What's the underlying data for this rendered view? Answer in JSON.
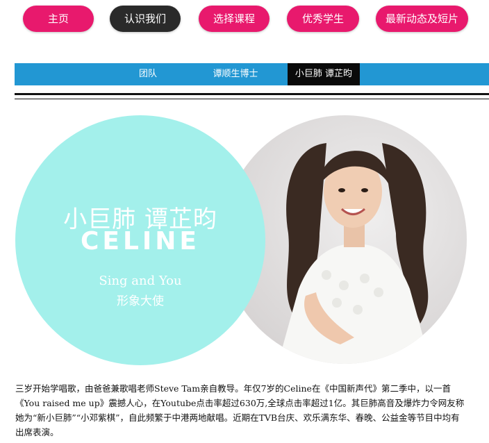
{
  "top_nav": {
    "items": [
      {
        "label": "主页",
        "style": "pink"
      },
      {
        "label": "认识我们",
        "style": "dark"
      },
      {
        "label": "选择课程",
        "style": "pink"
      },
      {
        "label": "优秀学生",
        "style": "pink"
      },
      {
        "label": "最新动态及短片",
        "style": "pink"
      }
    ]
  },
  "sub_nav": {
    "items": [
      {
        "label": "团队",
        "active": false
      },
      {
        "label": "谭顺生博士",
        "active": false
      },
      {
        "label": "小巨肺 谭芷昀",
        "active": true
      }
    ]
  },
  "hero": {
    "title_cn": "小巨肺  谭芷昀",
    "title_en": "CELINE",
    "tagline_en": "Sing and You",
    "tagline_cn": "形象大使",
    "photo_icon": "girl-portrait"
  },
  "description": "三岁开始学唱歌，由爸爸兼歌唱老师Steve Tam亲自教导。年仅7岁的Celine在《中国新声代》第二季中，以一首《You raised me up》震撼人心，在Youtube点击率超过630万,全球点击率超过1亿。其巨肺高音及爆炸力令网友称她为“新小巨肺”“小邓紫棋”，自此频繁于中港两地献唱。近期在TVB台庆、欢乐满东华、春晚、公益金等节目中均有出席表演。",
  "colors": {
    "accent_pink": "#e8196d",
    "dark_pill": "#2a2a2a",
    "sub_nav_blue": "#2297d3",
    "teal": "#a3f0eb"
  }
}
